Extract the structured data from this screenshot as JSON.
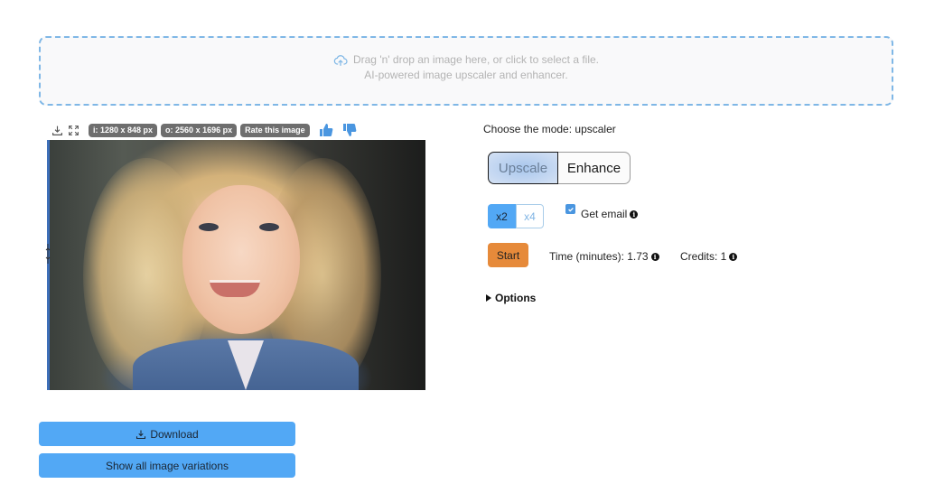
{
  "dropzone": {
    "line1": "Drag 'n' drop an image here, or click to select a file.",
    "line2": "AI-powered image upscaler and enhancer.",
    "icon": "cloud-upload-icon"
  },
  "image_toolbar": {
    "icons": [
      "download-icon",
      "fullscreen-icon"
    ],
    "input_size": "i: 1280 x 848 px",
    "output_size": "o: 2560 x 1696 px",
    "rate_label": "Rate this image",
    "thumbs_up": "thumbs-up-icon",
    "thumbs_down": "thumbs-down-icon"
  },
  "preview": {
    "description": "Portrait of a smiling young girl with blonde hair wearing a denim jacket",
    "comparison_slider_position": 0
  },
  "actions": {
    "download_label": "Download",
    "variations_label": "Show all image variations"
  },
  "settings": {
    "mode_label": "Choose the mode: upscaler",
    "modes": [
      {
        "label": "Upscale",
        "active": true
      },
      {
        "label": "Enhance",
        "active": false
      }
    ],
    "scales": [
      {
        "label": "x2",
        "active": true
      },
      {
        "label": "x4",
        "active": false
      }
    ],
    "get_email_label": "Get email",
    "get_email_checked": true,
    "start_label": "Start",
    "time_label": "Time (minutes): 1.73",
    "credits_label": "Credits: 1",
    "options_label": "Options"
  },
  "colors": {
    "accent_blue": "#52a8f5",
    "start_orange": "#e68a3a",
    "badge_gray": "#6e6e6e"
  }
}
